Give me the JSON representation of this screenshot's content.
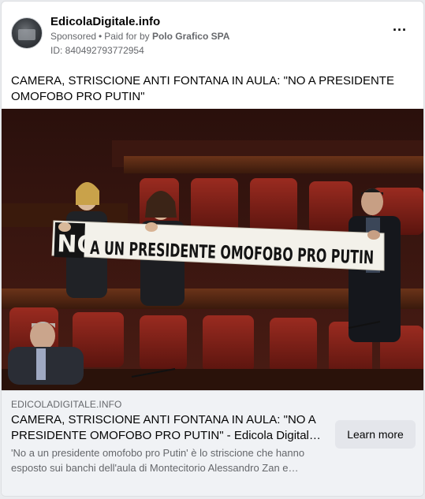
{
  "post": {
    "page_name": "EdicolaDigitale.info",
    "sponsored_label": "Sponsored",
    "separator": "•",
    "paid_for_prefix": "Paid for by",
    "payer": "Polo Grafico SPA",
    "ad_id": "ID: 840492793772954",
    "more_icon": "more-horizontal-icon",
    "more_glyph": "···",
    "caption": "CAMERA, STRISCIONE ANTI FONTANA IN AULA: \"NO A PRESIDENTE OMOFOBO PRO PUTIN\""
  },
  "photo": {
    "banner_text_no": "NO",
    "banner_text_rest": "A UN PRESIDENTE  OMOFOBO  PRO PUTIN"
  },
  "link": {
    "domain": "EDICOLADIGITALE.INFO",
    "title": "CAMERA, STRISCIONE ANTI FONTANA IN AULA: \"NO A PRESIDENTE OMOFOBO PRO PUTIN\" - Edicola Digitale | Edicola Digitale",
    "description": "'No a un presidente omofobo pro Putin' è lo striscione che hanno esposto sui banchi dell'aula di Montecitorio Alessandro Zan e…",
    "cta_label": "Learn more"
  },
  "colors": {
    "secondary_text": "#65676b",
    "primary_text": "#050505",
    "footer_bg": "#f0f2f5",
    "button_bg": "#e4e6eb"
  }
}
